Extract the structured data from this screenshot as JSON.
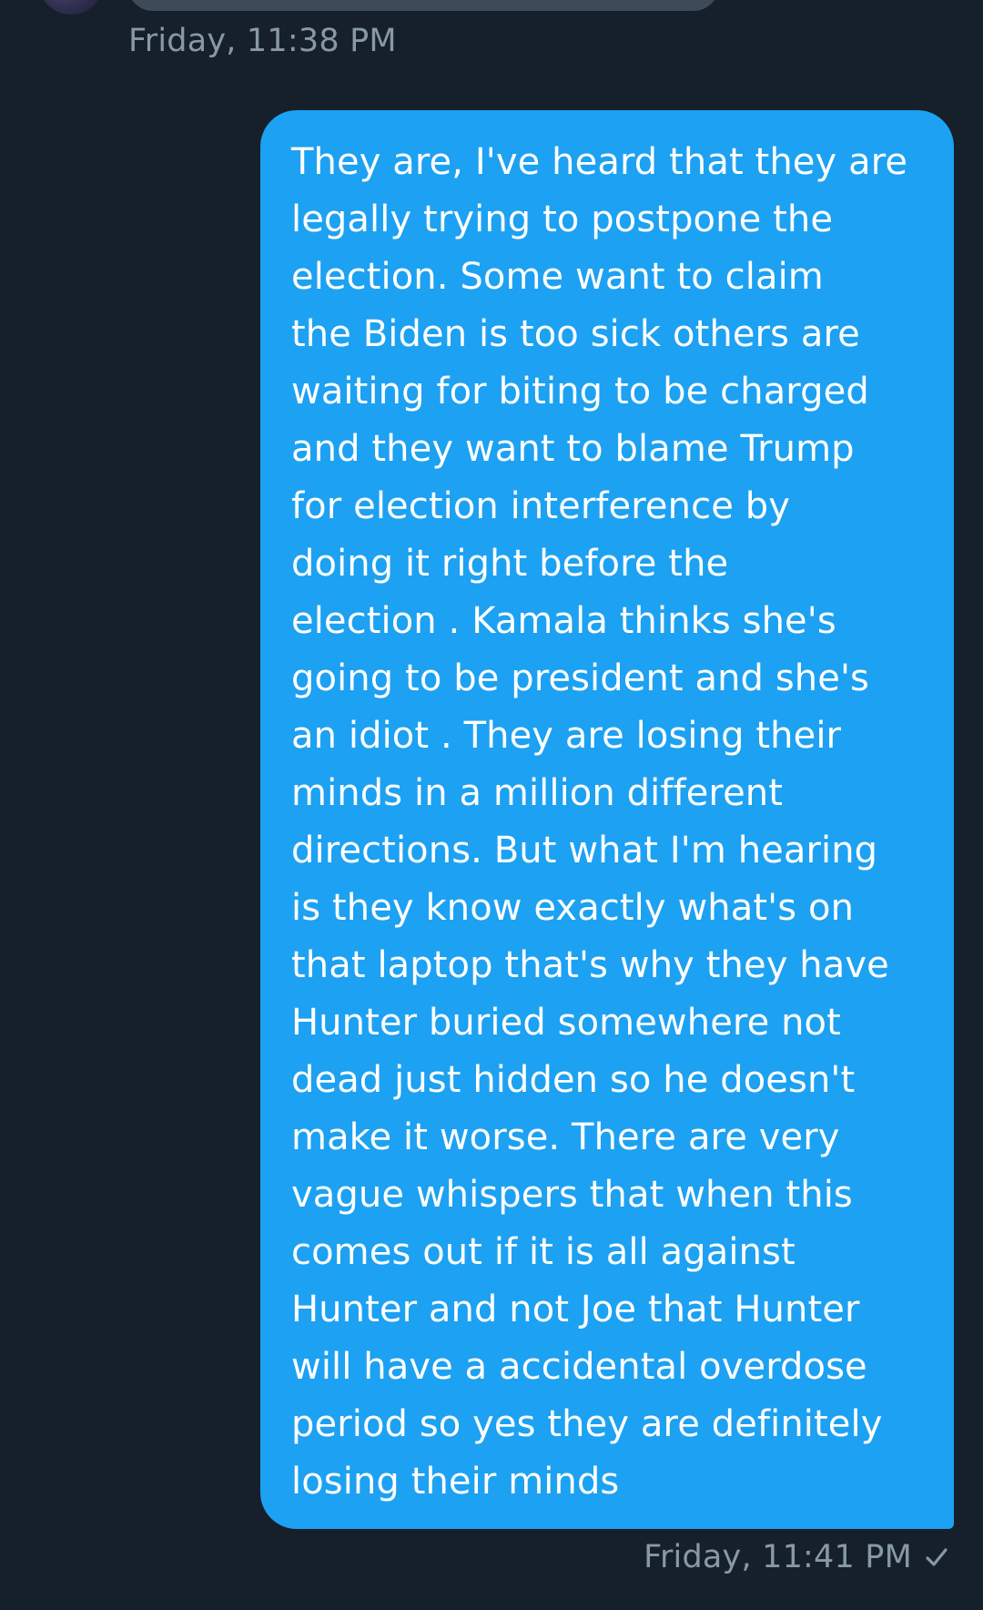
{
  "conversation": {
    "received_timestamp": "Friday, 11:38 PM",
    "sent_message": {
      "lines": [
        "They are, I've heard that they are",
        "legally trying to postpone the",
        "election. Some want to claim",
        "the Biden is too sick others are",
        "waiting for biting to be charged",
        "and they want to blame Trump",
        "for election interference by",
        "doing it right before the",
        "election . Kamala thinks she's",
        "going to be president and she's",
        "an idiot . They are losing their",
        "minds in a million different",
        "directions. But what I'm hearing",
        "is they know exactly what's on",
        "that laptop that's why they have",
        "Hunter buried somewhere not",
        "dead just hidden so he doesn't",
        "make it worse. There are very",
        "vague whispers that when this",
        "comes out if it is all against",
        "Hunter and not Joe that Hunter",
        "will have a accidental overdose",
        "period so yes they are definitely",
        "losing their minds"
      ],
      "timestamp": "Friday, 11:41 PM",
      "status_icon": "check-icon"
    }
  },
  "colors": {
    "background": "#15202b",
    "bubble": "#1da1f2",
    "timestamp": "#8899a6",
    "message_text": "#ffffff"
  }
}
